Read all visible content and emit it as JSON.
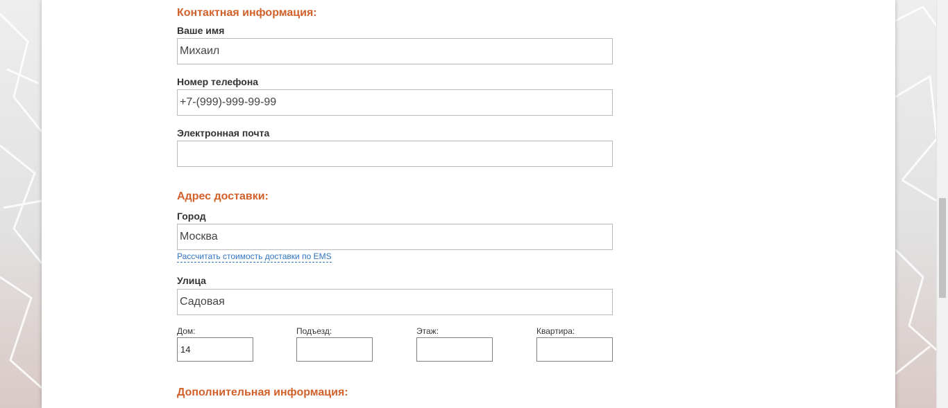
{
  "contact": {
    "title": "Контактная информация:",
    "name_label": "Ваше имя",
    "name_value": "Михаил",
    "phone_label": "Номер телефона",
    "phone_value": "+7-(999)-999-99-99",
    "email_label": "Электронная почта",
    "email_value": ""
  },
  "delivery": {
    "title": "Адрес доставки:",
    "city_label": "Город",
    "city_value": "Москва",
    "ems_link": "Рассчитать стоимость доставки по EMS",
    "street_label": "Улица",
    "street_value": "Садовая",
    "house_label": "Дом:",
    "house_value": "14",
    "entrance_label": "Подъезд:",
    "entrance_value": "",
    "floor_label": "Этаж:",
    "floor_value": "",
    "apartment_label": "Квартира:",
    "apartment_value": ""
  },
  "additional": {
    "title": "Дополнительная информация:"
  },
  "colors": {
    "section_title": "#d2602a",
    "link": "#2f74c0",
    "label": "#333333"
  }
}
